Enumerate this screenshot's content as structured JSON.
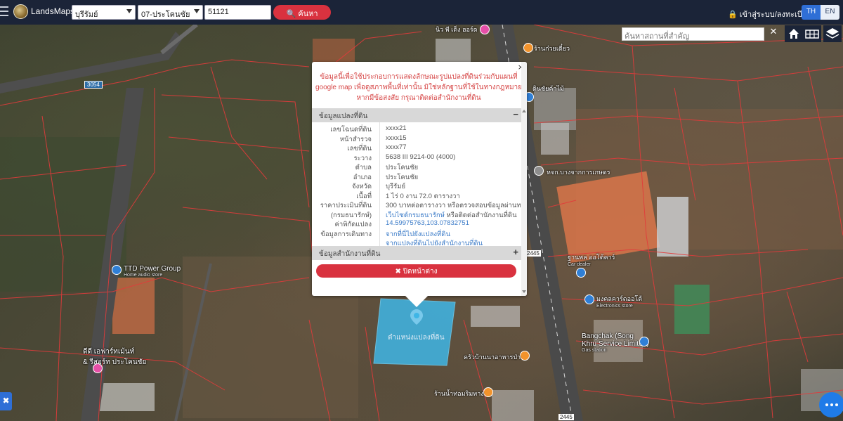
{
  "header": {
    "brand": "LandsMaps",
    "province": "บุรีรัมย์",
    "district": "07-ประโคนชัย",
    "deed_number": "51121",
    "search_label": "ค้นหา",
    "login_label": "เข้าสู่ระบบ/ลงทะเบียน",
    "lang_th": "TH",
    "lang_en": "EN"
  },
  "map_controls": {
    "place_search_placeholder": "ค้นหาสถานที่สำคัญ",
    "clear": "✕"
  },
  "popup": {
    "notice": "ข้อมูลนี้เพื่อใช้ประกอบการแสดงลักษณะรูปแปลงที่ดินร่วมกับแผนที่ google map เพื่อดูสภาพพื้นที่เท่านั้น มิใช่หลักฐานที่ใช้ในทางกฎหมาย หากมีข้อสงสัย กรุณาติดต่อสำนักงานที่ดิน",
    "close_x": "×",
    "section_parcel": "ข้อมูลแปลงที่ดิน",
    "section_office": "ข้อมูลสำนักงานที่ดิน",
    "collapse_sign": "−",
    "expand_sign": "+",
    "rows": [
      {
        "label": "เลขโฉนดที่ดิน",
        "value": "xxxx21"
      },
      {
        "label": "หน้าสำรวจ",
        "value": "xxxx15"
      },
      {
        "label": "เลขที่ดิน",
        "value": "xxxx77"
      },
      {
        "label": "ระวาง",
        "value": "5638 III 9214-00 (4000)"
      },
      {
        "label": "ตำบล",
        "value": "ประโคนชัย"
      },
      {
        "label": "อำเภอ",
        "value": "ประโคนชัย"
      },
      {
        "label": "จังหวัด",
        "value": "บุรีรัมย์"
      },
      {
        "label": "เนื้อที่",
        "value": "1 ไร่ 0 งาน 72.0 ตารางวา"
      },
      {
        "label": "ราคาประเมินที่ดิน",
        "value": "300 บาทต่อตารางวา หรือตรวจสอบข้อมูลผ่านทาง"
      },
      {
        "label": "(กรมธนารักษ์)",
        "value_link": "เว็บไซต์กรมธนารักษ์",
        "value_rest": " หรือติดต่อสำนักงานที่ดิน"
      },
      {
        "label": "ค่าพิกัดแปลง",
        "value": "14.59975763,103.07832751"
      },
      {
        "label": "ข้อมูลการเดินทาง",
        "value": "จากที่นี่ไปยังแปลงที่ดิน"
      },
      {
        "label": "",
        "value": "จากแปลงที่ดินไปยังสำนักงานที่ดิน"
      }
    ],
    "close_window_label": "✖ ปิดหน้าต่าง"
  },
  "map_labels": {
    "parcel_position": "ตำแหน่งแปลงที่ดิน",
    "road_3054": "3054",
    "road_2445_a": "2445",
    "road_2445_b": "2445",
    "poi_top": "นิว พี เด็ง ฮอร์ด",
    "poi_top2": "ร้านก๋วยเตี๋ยว",
    "poi_chai": "ดินชัยค้าไม้",
    "poi_bangchak_label": "หจก.บางจากการเกษตร",
    "poi_ttd": "TTD Power Group",
    "poi_ttd_sub": "Home audio store",
    "poi_car": "ฐานพล ออโต้คาร์",
    "poi_car_sub": "Car dealer",
    "poi_electronics": "มงคลคาร์ดออโต้",
    "poi_electronics_sub": "Electronics store",
    "poi_bangchak": "Bangchak (Song",
    "poi_bangchak2": "Khru Service Limited)",
    "poi_bangchak_sub": "Gas station",
    "poi_resort": "ดีดี เอฟาร์ทเม้นท์",
    "poi_resort2": "& รีสอร์ท ประโคนชัย",
    "poi_kitchen": "ครัวบ้านนาอาหารป่า",
    "poi_noodle": "ร้านน้ำท่อมริมทาง"
  },
  "colors": {
    "topbar": "#1b2438",
    "accent_red": "#d9323f",
    "accent_blue": "#2f6fd6",
    "parcel_fill": "#3fb6e6"
  }
}
